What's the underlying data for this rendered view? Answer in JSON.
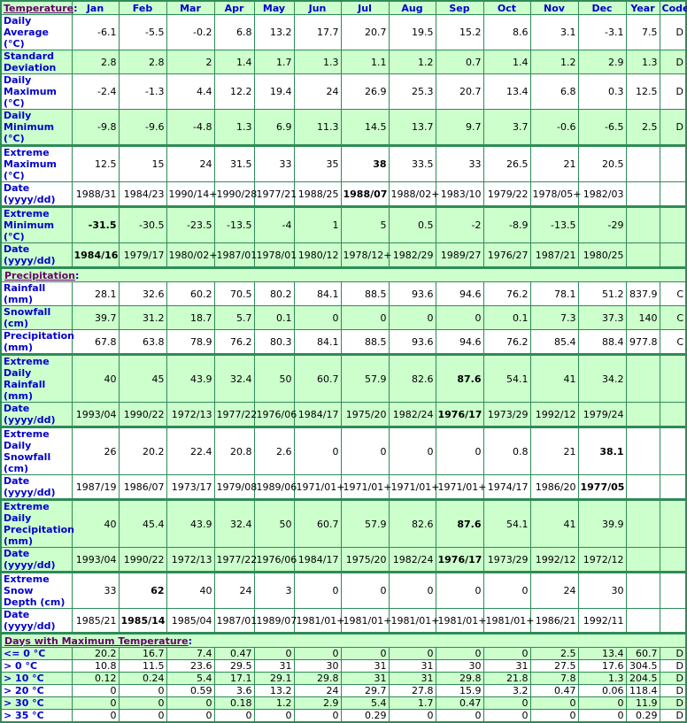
{
  "header": {
    "section_label": "Temperature",
    "columns": [
      "Jan",
      "Feb",
      "Mar",
      "Apr",
      "May",
      "Jun",
      "Jul",
      "Aug",
      "Sep",
      "Oct",
      "Nov",
      "Dec",
      "Year",
      "Code"
    ]
  },
  "temperature": {
    "rows": [
      {
        "label": "Daily Average (°C)",
        "values": [
          "-6.1",
          "-5.5",
          "-0.2",
          "6.8",
          "13.2",
          "17.7",
          "20.7",
          "19.5",
          "15.2",
          "8.6",
          "3.1",
          "-3.1",
          "7.5"
        ],
        "code": "D"
      },
      {
        "label": "Standard Deviation",
        "values": [
          "2.8",
          "2.8",
          "2",
          "1.4",
          "1.7",
          "1.3",
          "1.1",
          "1.2",
          "0.7",
          "1.4",
          "1.2",
          "2.9",
          "1.3"
        ],
        "code": "D"
      },
      {
        "label": "Daily Maximum (°C)",
        "values": [
          "-2.4",
          "-1.3",
          "4.4",
          "12.2",
          "19.4",
          "24",
          "26.9",
          "25.3",
          "20.7",
          "13.4",
          "6.8",
          "0.3",
          "12.5"
        ],
        "code": "D"
      },
      {
        "label": "Daily Minimum (°C)",
        "values": [
          "-9.8",
          "-9.6",
          "-4.8",
          "1.3",
          "6.9",
          "11.3",
          "14.5",
          "13.7",
          "9.7",
          "3.7",
          "-0.6",
          "-6.5",
          "2.5"
        ],
        "code": "D"
      },
      {
        "label": "Extreme Maximum (°C)",
        "values": [
          "12.5",
          "15",
          "24",
          "31.5",
          "33",
          "35",
          "38",
          "33.5",
          "33",
          "26.5",
          "21",
          "20.5",
          ""
        ],
        "code": ""
      },
      {
        "label": "Date (yyyy/dd)",
        "values": [
          "1988/31",
          "1984/23",
          "1990/14+",
          "1990/28",
          "1977/21",
          "1988/25",
          "1988/07",
          "1988/02+",
          "1983/10",
          "1979/22",
          "1978/05+",
          "1982/03",
          ""
        ],
        "code": ""
      },
      {
        "label": "Extreme Minimum (°C)",
        "values": [
          "-31.5",
          "-30.5",
          "-23.5",
          "-13.5",
          "-4",
          "1",
          "5",
          "0.5",
          "-2",
          "-8.9",
          "-13.5",
          "-29",
          ""
        ],
        "code": ""
      },
      {
        "label": "Date (yyyy/dd)",
        "values": [
          "1984/16",
          "1979/17",
          "1980/02+",
          "1987/01",
          "1978/01",
          "1980/12",
          "1978/12+",
          "1982/29",
          "1989/27",
          "1976/27",
          "1987/21",
          "1980/25",
          ""
        ],
        "code": ""
      }
    ]
  },
  "precipitation": {
    "section_label": "Precipitation",
    "rows": [
      {
        "label": "Rainfall (mm)",
        "values": [
          "28.1",
          "32.6",
          "60.2",
          "70.5",
          "80.2",
          "84.1",
          "88.5",
          "93.6",
          "94.6",
          "76.2",
          "78.1",
          "51.2",
          "837.9"
        ],
        "code": "C"
      },
      {
        "label": "Snowfall (cm)",
        "values": [
          "39.7",
          "31.2",
          "18.7",
          "5.7",
          "0.1",
          "0",
          "0",
          "0",
          "0",
          "0.1",
          "7.3",
          "37.3",
          "140"
        ],
        "code": "C"
      },
      {
        "label": "Precipitation (mm)",
        "values": [
          "67.8",
          "63.8",
          "78.9",
          "76.2",
          "80.3",
          "84.1",
          "88.5",
          "93.6",
          "94.6",
          "76.2",
          "85.4",
          "88.4",
          "977.8"
        ],
        "code": "C"
      },
      {
        "label": "Extreme Daily Rainfall (mm)",
        "values": [
          "40",
          "45",
          "43.9",
          "32.4",
          "50",
          "60.7",
          "57.9",
          "82.6",
          "87.6",
          "54.1",
          "41",
          "34.2",
          ""
        ],
        "code": ""
      },
      {
        "label": "Date (yyyy/dd)",
        "values": [
          "1993/04",
          "1990/22",
          "1972/13",
          "1977/22",
          "1976/06",
          "1984/17",
          "1975/20",
          "1982/24",
          "1976/17",
          "1973/29",
          "1992/12",
          "1979/24",
          ""
        ],
        "code": ""
      },
      {
        "label": "Extreme Daily Snowfall (cm)",
        "values": [
          "26",
          "20.2",
          "22.4",
          "20.8",
          "2.6",
          "0",
          "0",
          "0",
          "0",
          "0.8",
          "21",
          "38.1",
          ""
        ],
        "code": ""
      },
      {
        "label": "Date (yyyy/dd)",
        "values": [
          "1987/19",
          "1986/07",
          "1973/17",
          "1979/08",
          "1989/06",
          "1971/01+",
          "1971/01+",
          "1971/01+",
          "1971/01+",
          "1974/17",
          "1986/20",
          "1977/05",
          ""
        ],
        "code": ""
      },
      {
        "label": "Extreme Daily Precipitation (mm)",
        "values": [
          "40",
          "45.4",
          "43.9",
          "32.4",
          "50",
          "60.7",
          "57.9",
          "82.6",
          "87.6",
          "54.1",
          "41",
          "39.9",
          ""
        ],
        "code": ""
      },
      {
        "label": "Date (yyyy/dd)",
        "values": [
          "1993/04",
          "1990/22",
          "1972/13",
          "1977/22",
          "1976/06",
          "1984/17",
          "1975/20",
          "1982/24",
          "1976/17",
          "1973/29",
          "1992/12",
          "1972/12",
          ""
        ],
        "code": ""
      },
      {
        "label": "Extreme Snow Depth (cm)",
        "values": [
          "33",
          "62",
          "40",
          "24",
          "3",
          "0",
          "0",
          "0",
          "0",
          "0",
          "24",
          "30",
          ""
        ],
        "code": ""
      },
      {
        "label": "Date (yyyy/dd)",
        "values": [
          "1985/21",
          "1985/14",
          "1985/04",
          "1987/01",
          "1989/07",
          "1981/01+",
          "1981/01+",
          "1981/01+",
          "1981/01+",
          "1981/01+",
          "1986/21",
          "1992/11",
          ""
        ],
        "code": ""
      }
    ]
  },
  "days_max_temp": {
    "section_label": "Days with Maximum Temperature",
    "rows": [
      {
        "label": "<= 0 °C",
        "values": [
          "20.2",
          "16.7",
          "7.4",
          "0.47",
          "0",
          "0",
          "0",
          "0",
          "0",
          "0",
          "2.5",
          "13.4",
          "60.7"
        ],
        "code": "D"
      },
      {
        "label": "> 0 °C",
        "values": [
          "10.8",
          "11.5",
          "23.6",
          "29.5",
          "31",
          "30",
          "31",
          "31",
          "30",
          "31",
          "27.5",
          "17.6",
          "304.5"
        ],
        "code": "D"
      },
      {
        "label": "> 10 °C",
        "values": [
          "0.12",
          "0.24",
          "5.4",
          "17.1",
          "29.1",
          "29.8",
          "31",
          "31",
          "29.8",
          "21.8",
          "7.8",
          "1.3",
          "204.5"
        ],
        "code": "D"
      },
      {
        "label": "> 20 °C",
        "values": [
          "0",
          "0",
          "0.59",
          "3.6",
          "13.2",
          "24",
          "29.7",
          "27.8",
          "15.9",
          "3.2",
          "0.47",
          "0.06",
          "118.4"
        ],
        "code": "D"
      },
      {
        "label": "> 30 °C",
        "values": [
          "0",
          "0",
          "0",
          "0.18",
          "1.2",
          "2.9",
          "5.4",
          "1.7",
          "0.47",
          "0",
          "0",
          "0",
          "11.9"
        ],
        "code": "D"
      },
      {
        "label": "> 35 °C",
        "values": [
          "0",
          "0",
          "0",
          "0",
          "0",
          "0",
          "0.29",
          "0",
          "0",
          "0",
          "0",
          "0",
          "0.29"
        ],
        "code": "D"
      }
    ]
  },
  "highlights": {
    "bold_cells": [
      [
        "temperature",
        4,
        6
      ],
      [
        "temperature",
        5,
        6
      ],
      [
        "temperature",
        6,
        0
      ],
      [
        "temperature",
        7,
        0
      ],
      [
        "precipitation",
        3,
        8
      ],
      [
        "precipitation",
        4,
        8
      ],
      [
        "precipitation",
        5,
        11
      ],
      [
        "precipitation",
        6,
        11
      ],
      [
        "precipitation",
        7,
        8
      ],
      [
        "precipitation",
        8,
        8
      ],
      [
        "precipitation",
        9,
        1
      ],
      [
        "precipitation",
        10,
        1
      ]
    ]
  },
  "colors": {
    "border": "#2e8b57",
    "shaded_row": "#ccffcc",
    "label_text": "#0000cc",
    "section_link": "#660066"
  }
}
